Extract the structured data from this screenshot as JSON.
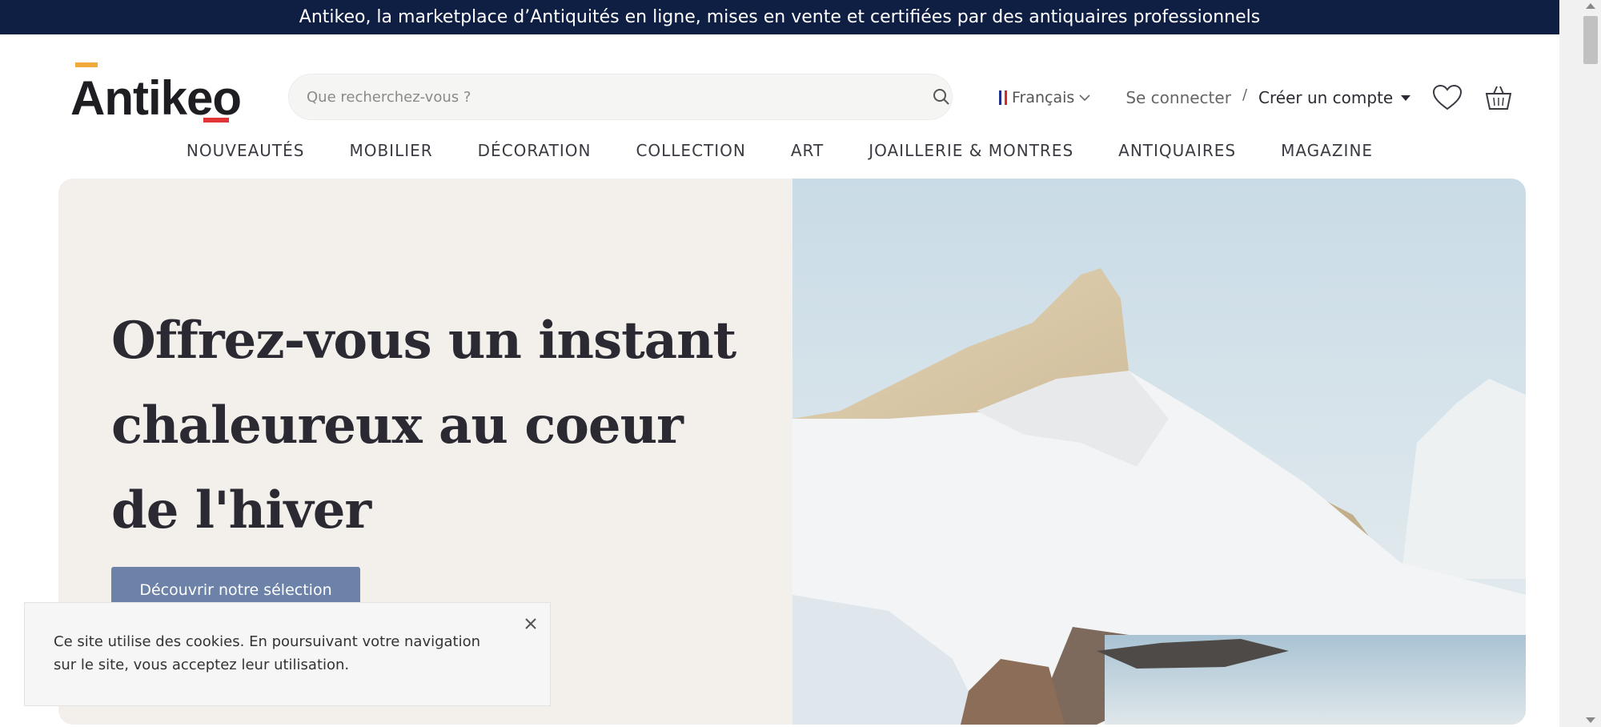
{
  "banner": {
    "text": "Antikeo, la marketplace d’Antiquités en ligne, mises en vente et certifiées par des antiquaires professionnels"
  },
  "logo": {
    "text": "Antikeo"
  },
  "search": {
    "placeholder": "Que recherchez-vous ?"
  },
  "language": {
    "label": "Français"
  },
  "account": {
    "login": "Se connecter",
    "separator": "/",
    "signup": "Créer un compte"
  },
  "nav": {
    "items": [
      "NOUVEAUTÉS",
      "MOBILIER",
      "DÉCORATION",
      "COLLECTION",
      "ART",
      "JOAILLERIE & MONTRES",
      "ANTIQUAIRES",
      "MAGAZINE"
    ]
  },
  "hero": {
    "title": "Offrez-vous un instant chaleureux au coeur de l'hiver",
    "cta": "Découvrir notre sélection"
  },
  "cookie": {
    "text": "Ce site utilise des cookies. En poursuivant votre navigation sur le site, vous acceptez leur utilisation."
  },
  "icons": {
    "search": "search-icon",
    "wishlist": "heart-icon",
    "cart": "basket-icon",
    "close": "close-icon",
    "flag": "french-flag-icon"
  },
  "colors": {
    "banner_bg": "#0f1f44",
    "cta_bg": "#6d82a8",
    "hero_bg": "#f3f0ec",
    "logo_accent_orange": "#f2a93b",
    "logo_accent_red": "#e23434"
  }
}
